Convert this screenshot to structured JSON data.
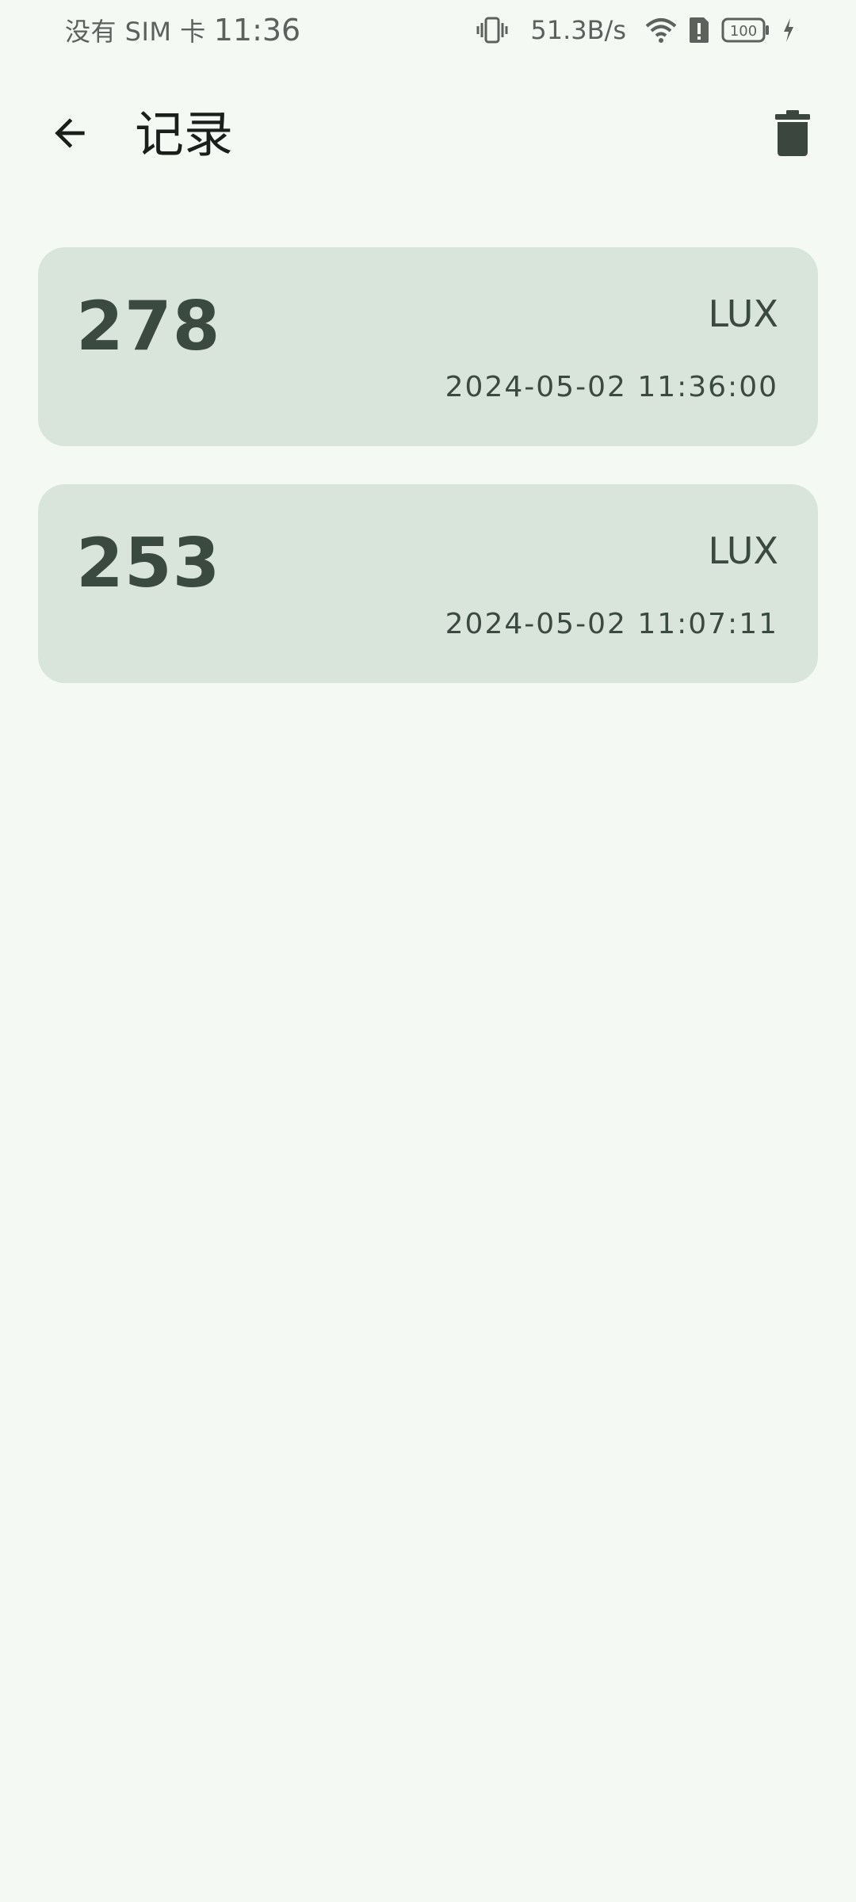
{
  "status_bar": {
    "carrier": "没有 SIM 卡",
    "time": "11:36",
    "network_speed": "51.3B/s",
    "battery": "100",
    "icons": [
      "vibrate-icon",
      "wifi-icon",
      "sim-alert-icon",
      "battery-icon",
      "charging-icon"
    ]
  },
  "app_bar": {
    "title": "记录",
    "back_icon": "arrow-back-icon",
    "delete_icon": "trash-icon"
  },
  "records": [
    {
      "value": "278",
      "unit": "LUX",
      "timestamp": "2024-05-02 11:36:00"
    },
    {
      "value": "253",
      "unit": "LUX",
      "timestamp": "2024-05-02 11:07:11"
    }
  ],
  "colors": {
    "background": "#f4f9f3",
    "card": "#d9e5da",
    "card_text": "#3b4a41",
    "icon_dark": "#3b463f"
  }
}
